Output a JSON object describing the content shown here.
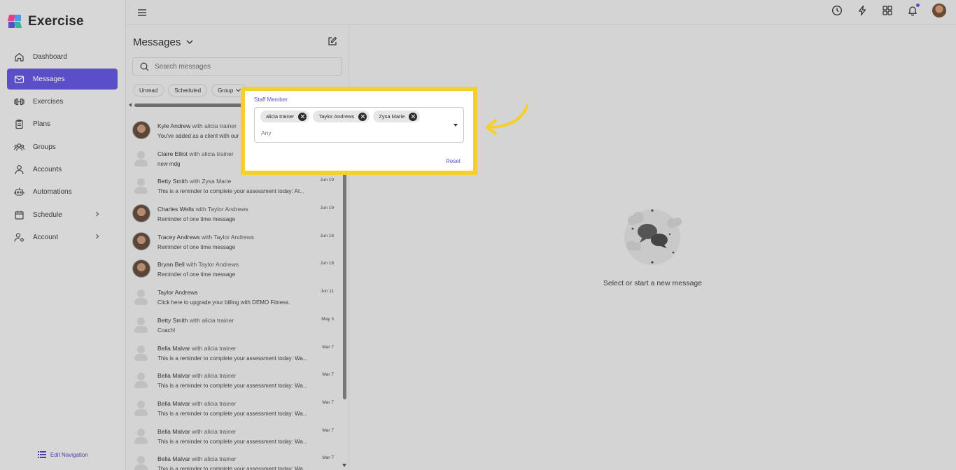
{
  "app": {
    "name": "Exercise"
  },
  "sidebar": {
    "items": [
      {
        "label": "Dashboard",
        "icon": "home-icon",
        "active": false,
        "chevron": false
      },
      {
        "label": "Messages",
        "icon": "mail-icon",
        "active": true,
        "chevron": false
      },
      {
        "label": "Exercises",
        "icon": "dumbbell-icon",
        "active": false,
        "chevron": false
      },
      {
        "label": "Plans",
        "icon": "clipboard-icon",
        "active": false,
        "chevron": false
      },
      {
        "label": "Groups",
        "icon": "users-icon",
        "active": false,
        "chevron": false
      },
      {
        "label": "Accounts",
        "icon": "user-icon",
        "active": false,
        "chevron": false
      },
      {
        "label": "Automations",
        "icon": "robot-icon",
        "active": false,
        "chevron": false
      },
      {
        "label": "Schedule",
        "icon": "calendar-icon",
        "active": false,
        "chevron": true
      },
      {
        "label": "Account",
        "icon": "user-gear-icon",
        "active": false,
        "chevron": true
      }
    ],
    "edit_nav": "Edit Navigation"
  },
  "topbar": {
    "icons": [
      "history-icon",
      "lightning-icon",
      "apps-grid-icon",
      "bell-icon",
      "profile-avatar"
    ],
    "notification_dot": true
  },
  "messages": {
    "title": "Messages",
    "search_placeholder": "Search messages",
    "filters": [
      "Unread",
      "Scheduled",
      "Group"
    ],
    "list": [
      {
        "name": "Kyle Andrew",
        "with": "with alicia trainer",
        "preview": "You've added as a client with our",
        "date": "",
        "avatar": "photo"
      },
      {
        "name": "Claire Elliot",
        "with": "with alicia trainer",
        "preview": "new mdg",
        "date": "",
        "avatar": "generic"
      },
      {
        "name": "Betty Smith",
        "with": "with Zysa Marie",
        "preview": "This is a reminder to complete your assessment today: At...",
        "date": "Jun 19",
        "avatar": "generic"
      },
      {
        "name": "Charles Wells",
        "with": "with Taylor Andrews",
        "preview": "Reminder of one time message",
        "date": "Jun 19",
        "avatar": "photo"
      },
      {
        "name": "Tracey Andrews",
        "with": "with Taylor Andrews",
        "preview": "Reminder of one time message",
        "date": "Jun 18",
        "avatar": "photo"
      },
      {
        "name": "Bryan Bell",
        "with": "with Taylor Andrews",
        "preview": "Reminder of one time message",
        "date": "Jun 18",
        "avatar": "photo"
      },
      {
        "name": "Taylor Andrews",
        "with": "",
        "preview": "Click here to upgrade your billing with DEMO Fitness.",
        "date": "Jun 11",
        "avatar": "generic"
      },
      {
        "name": "Betty Smith",
        "with": "with alicia trainer",
        "preview": "Coach!",
        "date": "May 3",
        "avatar": "generic"
      },
      {
        "name": "Bella Malvar",
        "with": "with alicia trainer",
        "preview": "This is a reminder to complete your assessment today: Wa...",
        "date": "Mar 7",
        "avatar": "generic"
      },
      {
        "name": "Bella Malvar",
        "with": "with alicia trainer",
        "preview": "This is a reminder to complete your assessment today: Wa...",
        "date": "Mar 7",
        "avatar": "generic"
      },
      {
        "name": "Bella Malvar",
        "with": "with alicia trainer",
        "preview": "This is a reminder to complete your assessment today: Wa...",
        "date": "Mar 7",
        "avatar": "generic"
      },
      {
        "name": "Bella Malvar",
        "with": "with alicia trainer",
        "preview": "This is a reminder to complete your assessment today: Wa...",
        "date": "Mar 7",
        "avatar": "generic"
      },
      {
        "name": "Bella Malvar",
        "with": "with alicia trainer",
        "preview": "This is a reminder to complete your assessment today: Wa...",
        "date": "Mar 7",
        "avatar": "generic"
      }
    ]
  },
  "empty_state": {
    "text": "Select or start a new message"
  },
  "staff_filter": {
    "label": "Staff Member",
    "selected": [
      "alicia trainer",
      "Taylor Andrews",
      "Zysa Marie"
    ],
    "placeholder": "Any",
    "reset": "Reset"
  },
  "colors": {
    "accent": "#5a4fc9",
    "highlight": "#f7cf2a"
  }
}
